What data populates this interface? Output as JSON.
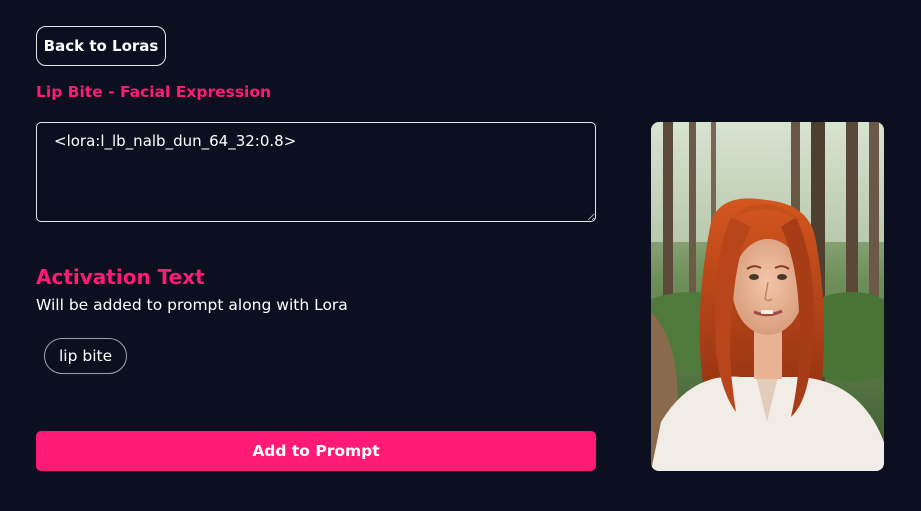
{
  "back_button": {
    "label": "Back to Loras"
  },
  "lora": {
    "title": "Lip Bite - Facial Expression",
    "tag_value": "<lora:l_lb_nalb_dun_64_32:0.8>"
  },
  "activation": {
    "heading": "Activation Text",
    "description": "Will be added to prompt along with Lora",
    "chips": [
      "lip bite"
    ]
  },
  "add_button": {
    "label": "Add to Prompt"
  },
  "colors": {
    "background": "#0c0f1f",
    "accent": "#ff1a75",
    "text": "#ffffff",
    "border": "#e5e7eb"
  }
}
